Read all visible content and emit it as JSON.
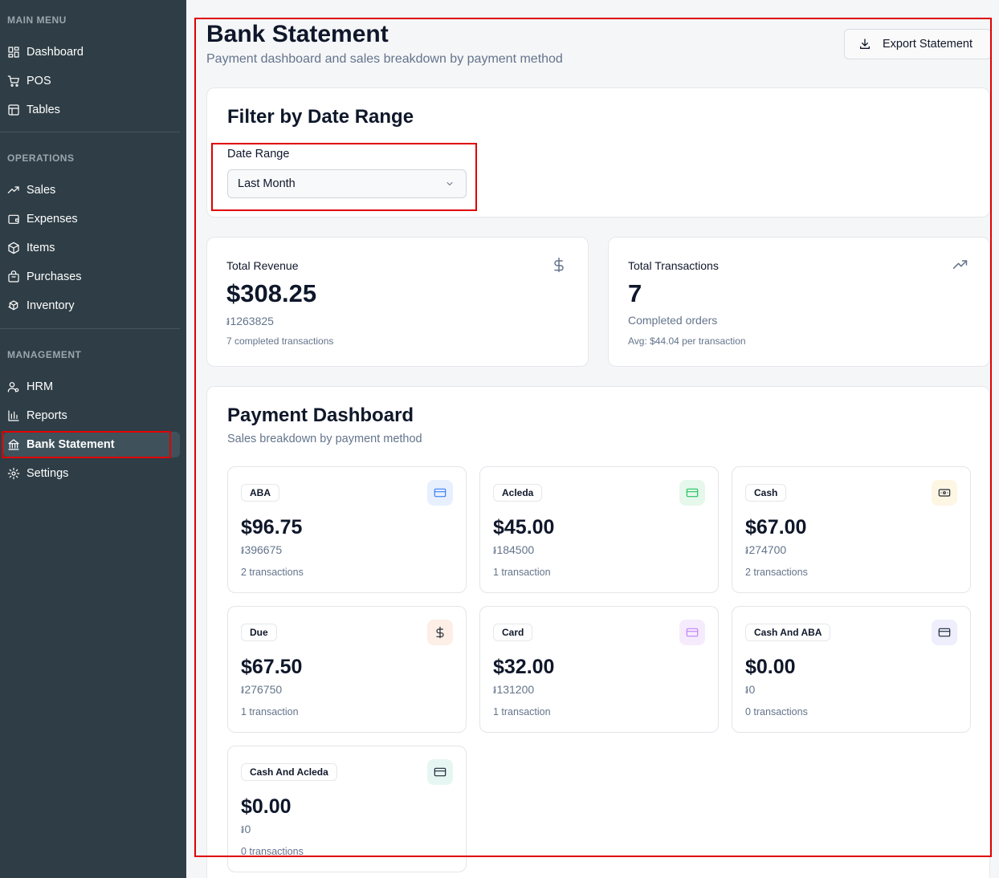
{
  "sidebar": {
    "sections": [
      {
        "title": "MAIN MENU",
        "items": [
          {
            "label": "Dashboard",
            "icon": "grid-icon"
          },
          {
            "label": "POS",
            "icon": "cart-icon"
          },
          {
            "label": "Tables",
            "icon": "table-icon"
          }
        ]
      },
      {
        "title": "OPERATIONS",
        "items": [
          {
            "label": "Sales",
            "icon": "trend-icon"
          },
          {
            "label": "Expenses",
            "icon": "wallet-icon"
          },
          {
            "label": "Items",
            "icon": "package-icon"
          },
          {
            "label": "Purchases",
            "icon": "purchases-icon"
          },
          {
            "label": "Inventory",
            "icon": "boxes-icon"
          }
        ]
      },
      {
        "title": "MANAGEMENT",
        "items": [
          {
            "label": "HRM",
            "icon": "users-icon"
          },
          {
            "label": "Reports",
            "icon": "bar-chart-icon"
          },
          {
            "label": "Bank Statement",
            "icon": "bank-icon",
            "active": true
          },
          {
            "label": "Settings",
            "icon": "gear-icon"
          }
        ]
      }
    ]
  },
  "header": {
    "title": "Bank Statement",
    "subtitle": "Payment dashboard and sales breakdown by payment method",
    "export_label": "Export Statement"
  },
  "filter": {
    "title": "Filter by Date Range",
    "label": "Date Range",
    "selected": "Last Month"
  },
  "stats": {
    "revenue": {
      "label": "Total Revenue",
      "value": "$308.25",
      "riel": "៛1263825",
      "note": "7 completed transactions"
    },
    "transactions": {
      "label": "Total Transactions",
      "value": "7",
      "sub": "Completed orders",
      "note": "Avg: $44.04 per transaction"
    }
  },
  "payment_dashboard": {
    "title": "Payment Dashboard",
    "subtitle": "Sales breakdown by payment method",
    "methods": [
      {
        "name": "ABA",
        "amount": "$96.75",
        "riel": "៛396675",
        "transactions": "2 transactions",
        "icon": "credit-card-icon",
        "tint": "#e8f0fe",
        "stroke": "#3b82f6"
      },
      {
        "name": "Acleda",
        "amount": "$45.00",
        "riel": "៛184500",
        "transactions": "1 transaction",
        "icon": "credit-card-icon",
        "tint": "#e6f7ec",
        "stroke": "#22c55e"
      },
      {
        "name": "Cash",
        "amount": "$67.00",
        "riel": "៛274700",
        "transactions": "2 transactions",
        "icon": "banknote-icon",
        "tint": "#fdf6e3",
        "stroke": "#1f2937"
      },
      {
        "name": "Due",
        "amount": "$67.50",
        "riel": "៛276750",
        "transactions": "1 transaction",
        "icon": "dollar-icon",
        "tint": "#fdefe6",
        "stroke": "#1f2937"
      },
      {
        "name": "Card",
        "amount": "$32.00",
        "riel": "៛131200",
        "transactions": "1 transaction",
        "icon": "credit-card-icon",
        "tint": "#f6ebfc",
        "stroke": "#c084fc"
      },
      {
        "name": "Cash And ABA",
        "amount": "$0.00",
        "riel": "៛0",
        "transactions": "0 transactions",
        "icon": "wallet-card-icon",
        "tint": "#eeeefc",
        "stroke": "#1f2937"
      },
      {
        "name": "Cash And Acleda",
        "amount": "$0.00",
        "riel": "៛0",
        "transactions": "0 transactions",
        "icon": "wallet-card-icon",
        "tint": "#e6f6f3",
        "stroke": "#1f2937"
      }
    ]
  }
}
